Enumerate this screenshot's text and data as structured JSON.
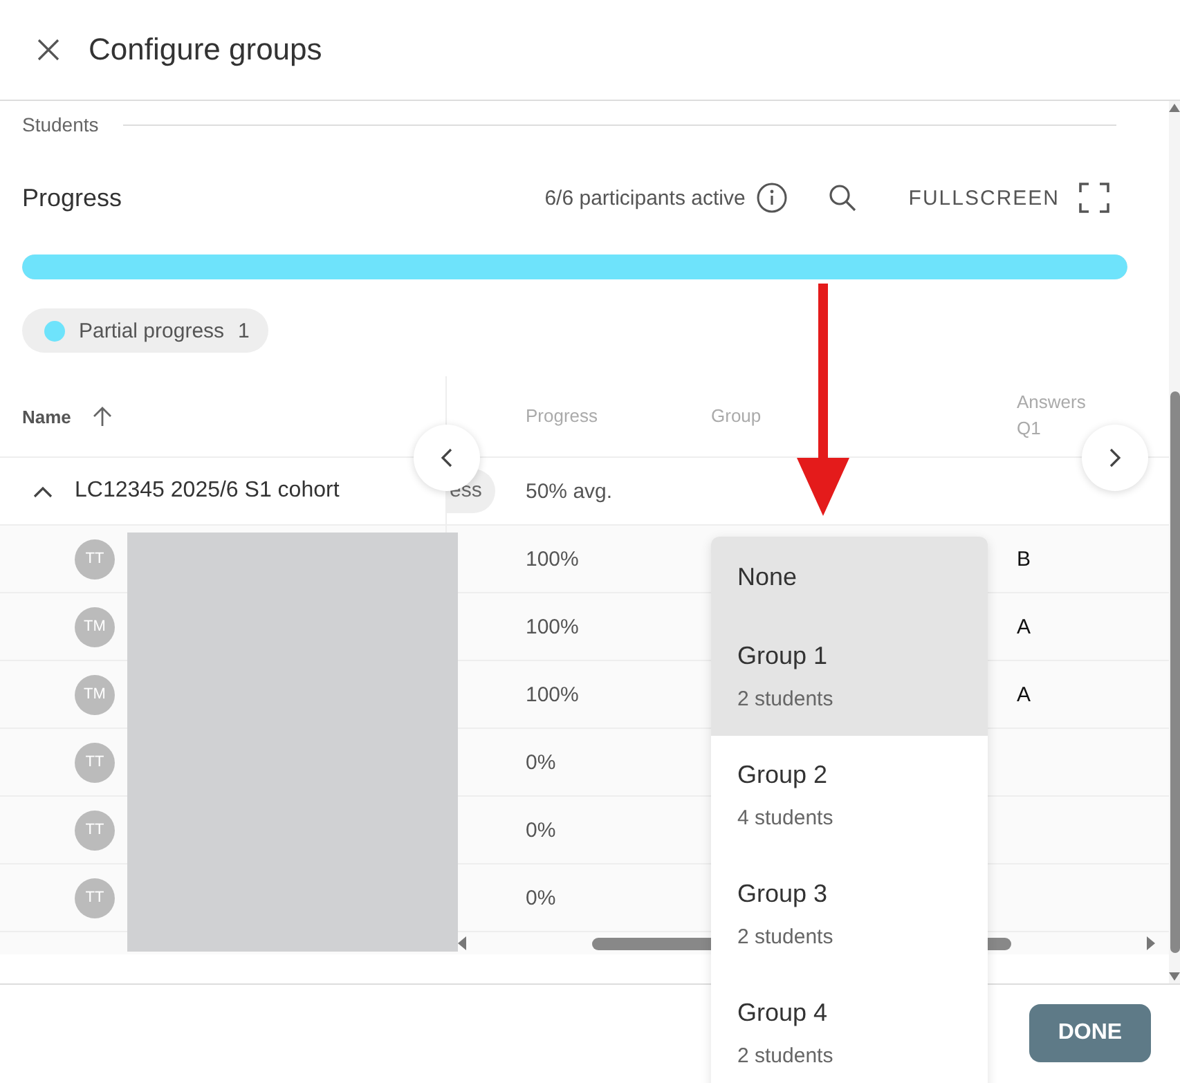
{
  "header": {
    "title": "Configure groups"
  },
  "section_label": "Students",
  "progress": {
    "title": "Progress",
    "participants": "6/6 participants active",
    "fullscreen_label": "FULLSCREEN",
    "level": 1
  },
  "legend": [
    {
      "label": "Partial progress",
      "count": "1",
      "color": "#6ee3fb"
    }
  ],
  "table": {
    "columns": [
      "Name",
      "Progress",
      "Group",
      "Answers Q1"
    ],
    "group_row": {
      "name": "LC12345 2025/6 S1 cohort",
      "expanded": true,
      "status": "ess",
      "progress": "50% avg."
    },
    "rows": [
      {
        "initials": "TT",
        "progress": "100%",
        "answer": "B"
      },
      {
        "initials": "TM",
        "progress": "100%",
        "answer": "A"
      },
      {
        "initials": "TM",
        "progress": "100%",
        "answer": "A"
      },
      {
        "initials": "TT",
        "progress": "0%"
      },
      {
        "initials": "TT",
        "progress": "0%"
      },
      {
        "initials": "TT",
        "progress": "0%"
      }
    ]
  },
  "dropdown": {
    "options": [
      {
        "label": "None",
        "highlighted": true
      },
      {
        "label": "Group 1",
        "count": "2 students",
        "highlighted": true
      },
      {
        "label": "Group 2",
        "count": "4 students",
        "highlighted": false
      },
      {
        "label": "Group 3",
        "count": "2 students",
        "highlighted": false
      },
      {
        "label": "Group 4",
        "count": "2 students",
        "highlighted": false
      }
    ]
  },
  "footer": {
    "button": "DONE"
  }
}
